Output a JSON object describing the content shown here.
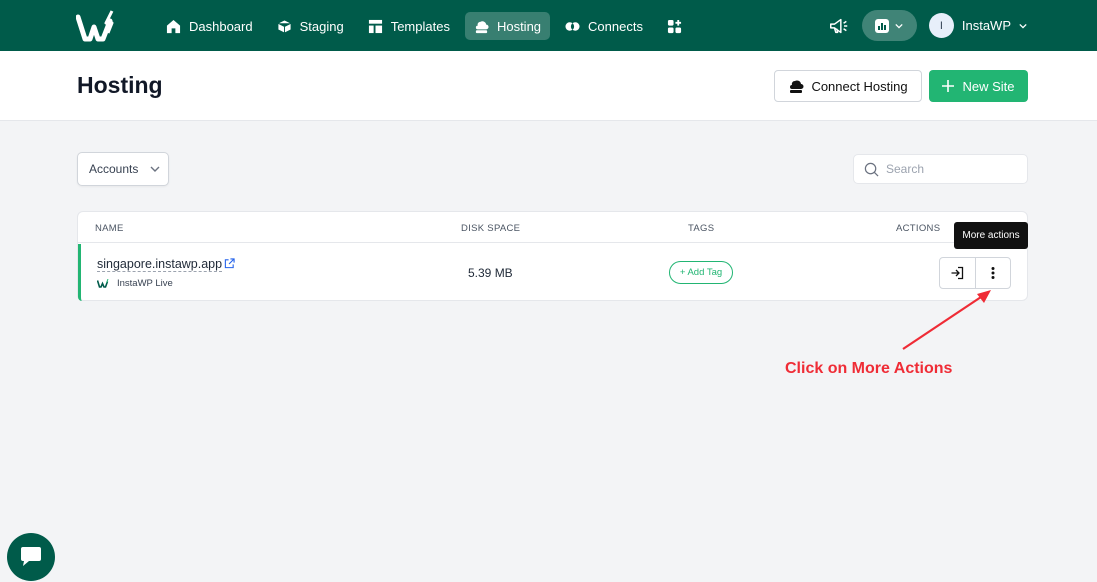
{
  "nav": {
    "items": [
      {
        "label": "Dashboard",
        "icon": "home-icon"
      },
      {
        "label": "Staging",
        "icon": "cube-icon"
      },
      {
        "label": "Templates",
        "icon": "template-icon"
      },
      {
        "label": "Hosting",
        "icon": "cloud-server-icon",
        "active": true
      },
      {
        "label": "Connects",
        "icon": "connects-icon"
      },
      {
        "label": "",
        "icon": "apps-grid-icon"
      }
    ],
    "user": {
      "avatar_initial": "I",
      "name": "InstaWP"
    }
  },
  "header": {
    "title": "Hosting",
    "connect_label": "Connect Hosting",
    "new_site_label": "New Site"
  },
  "filters": {
    "accounts_label": "Accounts",
    "search_placeholder": "Search"
  },
  "table": {
    "columns": {
      "name": "NAME",
      "disk": "DISK SPACE",
      "tags": "TAGS",
      "actions": "ACTIONS"
    },
    "rows": [
      {
        "site": "singapore.instawp.app",
        "host": "InstaWP Live",
        "disk": "5.39 MB",
        "tag_button": "+ Add Tag"
      }
    ]
  },
  "tooltip": "More actions",
  "annotation": "Click on More Actions",
  "colors": {
    "brand": "#005b4a",
    "accent": "#22b573",
    "annotation": "#ef2c36"
  }
}
